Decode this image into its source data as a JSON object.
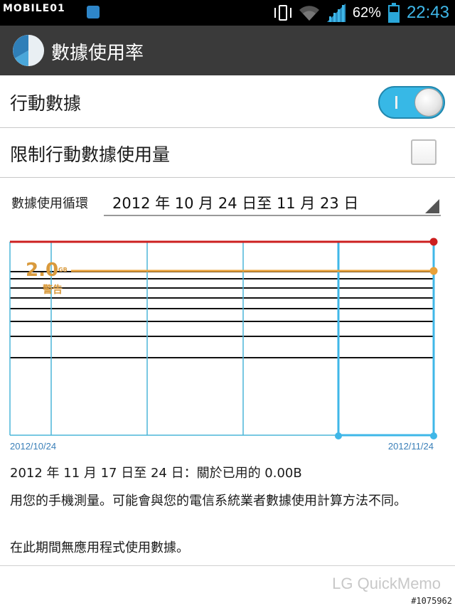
{
  "statusbar": {
    "watermark": "MOBILE01",
    "battery_percent_text": "62%",
    "battery_level": 0.62,
    "time": "22:43",
    "icons": [
      "vibrate-icon",
      "wifi-icon",
      "signal-icon",
      "battery-icon"
    ]
  },
  "actionbar": {
    "title": "數據使用率",
    "icon": "data-usage-pie-icon"
  },
  "mobile_data": {
    "label": "行動數據",
    "enabled": true,
    "toggle_text": "I"
  },
  "limit_data": {
    "label": "限制行動數據使用量",
    "checked": false
  },
  "cycle": {
    "label": "數據使用循環",
    "value": "2012 年 10 月 24 日至 11 月 23 日"
  },
  "chart_data": {
    "type": "line",
    "x_start_label": "2012/10/24",
    "x_end_label": "2012/11/24",
    "limit_line_color": "#cc1f1f",
    "warning_line_color": "#e8a13a",
    "warning_value": "2.0",
    "warning_unit": "GB",
    "warning_label": "警告",
    "accent": "#3fb7e8"
  },
  "summary": "2012 年 11 月 17 日至 24 日：關於已用的 0.00B",
  "note": "用您的手機測量。可能會與您的電信系統業者數據使用計算方法不同。",
  "no_apps": "在此期間無應用程式使用數據。",
  "footer": {
    "quickmemo": "LG QuickMemo",
    "photo_id": "#1075962"
  }
}
